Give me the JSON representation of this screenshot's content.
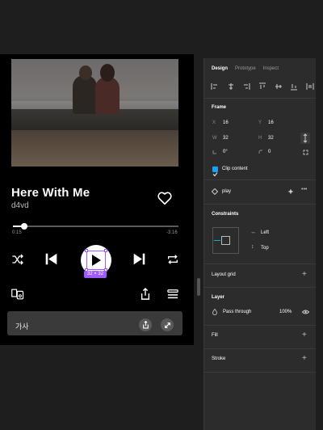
{
  "player": {
    "song_title": "Here With Me",
    "artist": "d4vd",
    "time_elapsed": "0:15",
    "time_remaining": "-3:16",
    "progress_fraction": 0.07,
    "selection_size": "32 × 32",
    "lyrics_label": "가사"
  },
  "panel": {
    "tabs": [
      "Design",
      "Prototype",
      "Inspect"
    ],
    "active_tab": "Design",
    "frame": {
      "title": "Frame",
      "x_label": "X",
      "x_value": "16",
      "y_label": "Y",
      "y_value": "16",
      "w_label": "W",
      "w_value": "32",
      "h_label": "H",
      "h_value": "32",
      "rotation_value": "0°",
      "radius_value": "0",
      "clip_label": "Clip content"
    },
    "component": "play",
    "constraints": {
      "title": "Constraints",
      "horizontal": "Left",
      "vertical": "Top"
    },
    "layout_grid": "Layout grid",
    "layer": {
      "title": "Layer",
      "blend": "Pass through",
      "opacity": "100%"
    },
    "fill": "Fill",
    "stroke": "Stroke"
  },
  "colors": {
    "accent": "#a259ff",
    "blue": "#18a0fb",
    "panel_bg": "#2c2c2c",
    "canvas_bg": "#1e1e1e"
  }
}
